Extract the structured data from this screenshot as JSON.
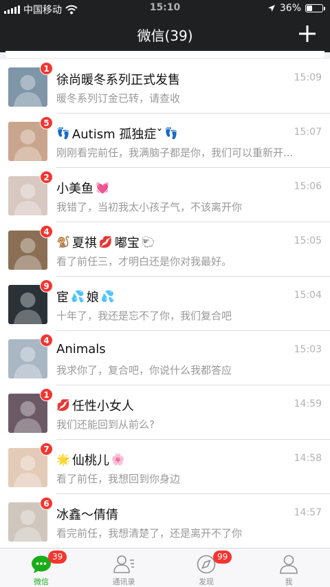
{
  "status_bar": {
    "carrier": "中国移动",
    "time": "15:10",
    "battery": "36%",
    "battery_level": 0.36
  },
  "header": {
    "title": "微信(39)",
    "add_icon": "plus-icon"
  },
  "chats": [
    {
      "name": "徐尚暖冬系列正式发售",
      "time": "15:09",
      "preview": "暖冬系列订金已转，请查收",
      "unread": "1",
      "avatar_color": "#7f95a8"
    },
    {
      "name": "Autism 孤独症ˇ",
      "name_prefix": "👣",
      "name_suffix": "👣",
      "time": "15:07",
      "preview": "刚刚看完前任，我满脑子都是你，我们可以重新开...",
      "unread": "5",
      "avatar_color": "#c9a58d"
    },
    {
      "name": "小美鱼",
      "name_suffix": "💓",
      "time": "15:06",
      "preview": "我错了，当初我太小孩子气，不该离开你",
      "unread": "2",
      "avatar_color": "#d8c8c2"
    },
    {
      "name": "夏祺",
      "name_prefix": "🐒",
      "name_mid": "💋",
      "name_2": "嘟宝",
      "name_suffix": "🐑",
      "time": "15:05",
      "preview": "看了前任三，才明白还是你对我最好。",
      "unread": "4",
      "avatar_color": "#8a6f55"
    },
    {
      "name": "宦",
      "name_mid": "💦",
      "name_2": "娘",
      "name_suffix": "💦",
      "time": "15:04",
      "preview": "十年了，我还是忘不了你，我们复合吧",
      "unread": "9",
      "avatar_color": "#2a3238"
    },
    {
      "name": "Animals",
      "time": "15:03",
      "preview": "我求你了，复合吧，你说什么我都答应",
      "unread": "4",
      "avatar_color": "#a9b7c4"
    },
    {
      "name": "任性小女人",
      "name_prefix": "💋",
      "time": "14:59",
      "preview": "我们还能回到从前么?",
      "unread": "1",
      "avatar_color": "#6b5a66"
    },
    {
      "name": "仙桃儿",
      "name_prefix": "🌟",
      "name_suffix": "🌸",
      "time": "14:58",
      "preview": "看了前任，我想回到你身边",
      "unread": "7",
      "avatar_color": "#e3cbb8"
    },
    {
      "name": "冰鑫～倩倩",
      "time": "14:57",
      "preview": "看完前任，我想清楚了，还是离开不了你",
      "unread": "6",
      "avatar_color": "#cfc6bd"
    }
  ],
  "tabbar": {
    "tabs": [
      {
        "label": "微信",
        "badge": "39",
        "icon": "chat-bubble-icon",
        "active": true
      },
      {
        "label": "通讯录",
        "icon": "contacts-icon"
      },
      {
        "label": "发现",
        "badge": "99",
        "icon": "compass-icon"
      },
      {
        "label": "我",
        "icon": "person-icon"
      }
    ]
  },
  "colors": {
    "header_bg": "#1f2022",
    "badge_red": "#f43530",
    "active_green": "#1aad19"
  }
}
